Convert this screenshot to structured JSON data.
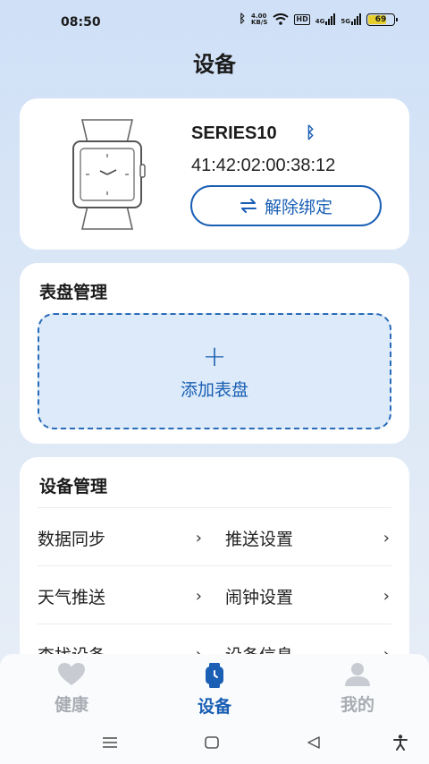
{
  "status": {
    "time": "08:50",
    "net_speed": "4.00\nKB/S",
    "hd_label": "HD",
    "sim1_label": "4G",
    "sim2_label": "5G",
    "battery": "69"
  },
  "page_title": "设备",
  "device": {
    "name": "SERIES10",
    "mac": "41:42:02:00:38:12",
    "unbind_label": "解除绑定"
  },
  "dial": {
    "section_title": "表盘管理",
    "add_label": "添加表盘"
  },
  "manage": {
    "section_title": "设备管理",
    "items": [
      {
        "label": "数据同步"
      },
      {
        "label": "推送设置"
      },
      {
        "label": "天气推送"
      },
      {
        "label": "闹钟设置"
      },
      {
        "label": "查找设备"
      },
      {
        "label": "设备信息"
      }
    ]
  },
  "tabs": [
    {
      "label": "健康",
      "icon": "heart-icon",
      "active": false
    },
    {
      "label": "设备",
      "icon": "watch-icon",
      "active": true
    },
    {
      "label": "我的",
      "icon": "person-icon",
      "active": false
    }
  ],
  "colors": {
    "accent": "#1a5fb4",
    "inactive": "#a9adb3",
    "dial_fill": "#dceaf9"
  }
}
